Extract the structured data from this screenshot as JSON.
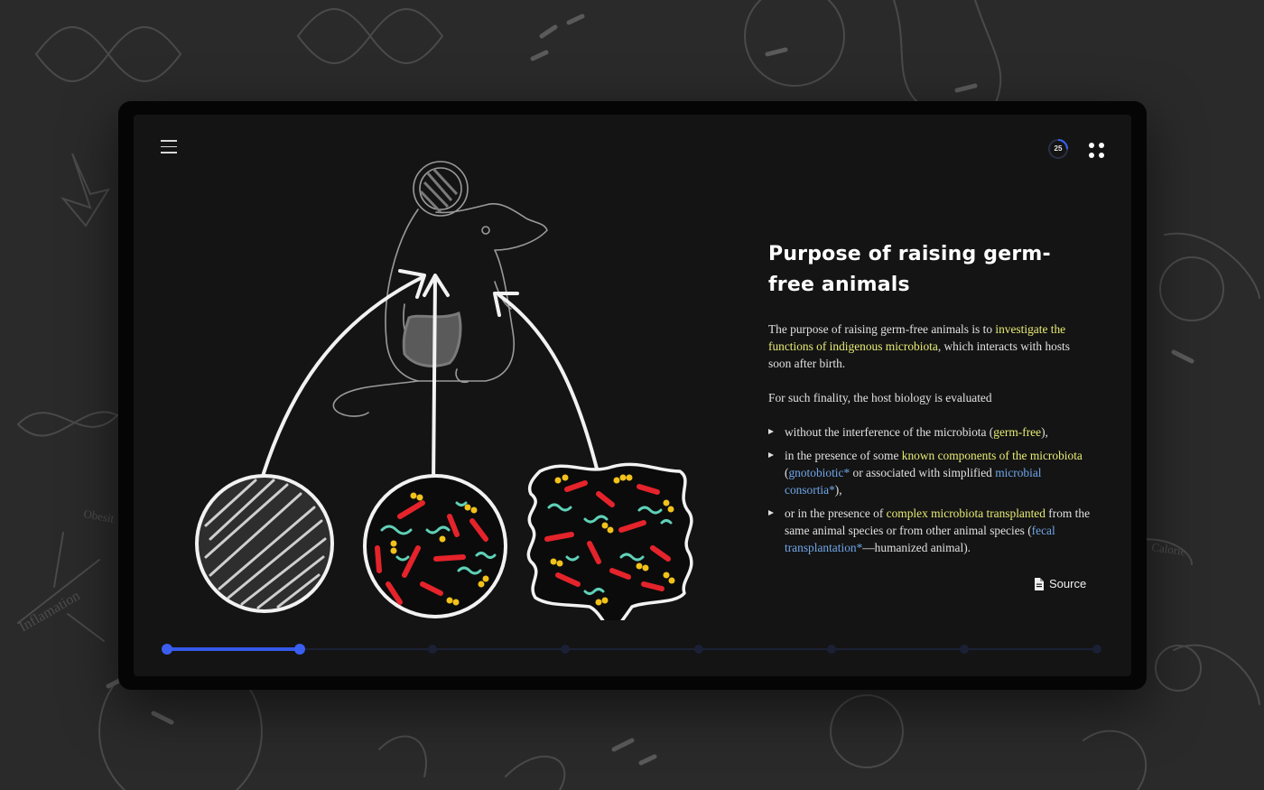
{
  "header": {
    "menu_icon": "hamburger-menu-icon",
    "progress_value": "25",
    "progress_fraction": 0.25,
    "grid_icon": "grid-dots-icon"
  },
  "slide": {
    "title": "Purpose of raising germ-free animals",
    "intro": {
      "before": "The purpose of raising germ-free animals is to ",
      "highlight": "investigate the functions of indigenous microbiota",
      "after": ", which interacts with hosts soon after birth."
    },
    "finality": "For such finality, the host biology is evaluated",
    "bullets": [
      {
        "before": "without the interference of the microbiota (",
        "highlight": "germ-free",
        "after": "),"
      },
      {
        "before": "in the presence of some ",
        "highlight": "known components of the microbiota",
        "mid": " (",
        "link": "gnotobiotic*",
        "mid2": " or associated with simplified ",
        "link2": "microbial consortia*",
        "after": "),"
      },
      {
        "before": "or in the presence of ",
        "highlight": "complex microbiota transplanted",
        "mid": " from the same animal species or from other animal species (",
        "link": "fecal transplantation*",
        "after": "—humanized animal)."
      }
    ],
    "source_label": "Source",
    "source_icon": "document-icon"
  },
  "timeline": {
    "total_steps": 8,
    "current_step": 2
  },
  "colors": {
    "accent_blue": "#3559ea",
    "highlight_yellow": "#e8ec74",
    "link_blue": "#6fa6e9",
    "bacteria_red": "#e5232b",
    "bacteria_yellow": "#f2c21b",
    "bacteria_teal": "#5fd1b8"
  }
}
